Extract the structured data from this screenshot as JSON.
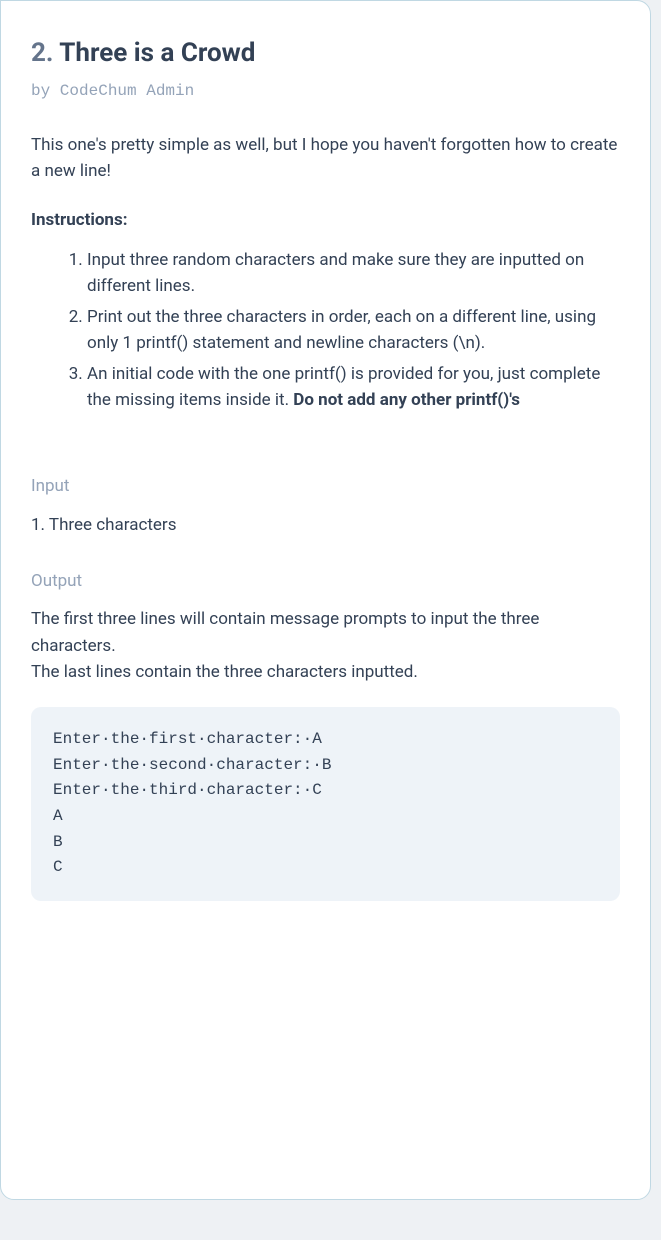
{
  "title_number": "2.",
  "title_text": "Three is a Crowd",
  "byline": "by CodeChum Admin",
  "intro": "This one's pretty simple as well, but I hope you haven't forgotten how to create a new line!",
  "instructions_label": "Instructions:",
  "instructions": {
    "item1": "Input three random characters and make sure they are inputted on different lines.",
    "item2": "Print out the three characters in order, each on a different line, using only 1 printf() statement and newline characters (\\n).",
    "item3_a": "An initial code with the one printf() is provided for you, just complete the missing items inside it. ",
    "item3_b": "Do not add any other printf()'s"
  },
  "input_label": "Input",
  "input_desc": "1. Three characters",
  "output_label": "Output",
  "output_desc1": "The first three lines will contain message prompts to input the three characters.",
  "output_desc2": "The last lines contain the three characters inputted.",
  "sample_output": "Enter·the·first·character:·A\nEnter·the·second·character:·B\nEnter·the·third·character:·C\nA\nB\nC"
}
